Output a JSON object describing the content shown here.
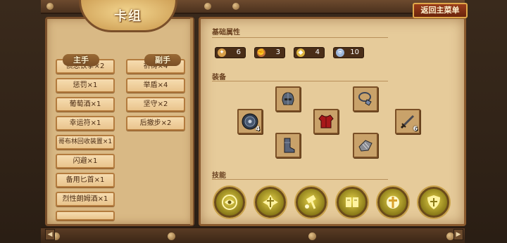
{
  "header": {
    "title": "卡组",
    "back_button": "返回主菜单"
  },
  "left_panel": {
    "main_hand_label": "主手",
    "off_hand_label": "副手",
    "main_hand_cards": [
      "愤怒铁拳×2",
      "惩罚×1",
      "葡萄酒×1",
      "幸运符×1",
      "哥布林回收装置×1",
      "闪避×1",
      "备用匕首×1",
      "烈性朗姆酒×1"
    ],
    "off_hand_cards": [
      "祈祷×4",
      "举盾×4",
      "坚守×2",
      "后撤步×2"
    ]
  },
  "right_panel": {
    "basic_attrs_title": "基础属性",
    "equipment_title": "装备",
    "skills_title": "技能",
    "stats": [
      {
        "icon": "sword-star-icon",
        "value": "6",
        "color": "#d8a04a"
      },
      {
        "icon": "fist-icon",
        "value": "3",
        "color": "#c8743a"
      },
      {
        "icon": "shield-icon",
        "value": "4",
        "color": "#e0b640"
      },
      {
        "icon": "armor-icon",
        "value": "10",
        "color": "#9ab4d8"
      }
    ],
    "equipment": [
      {
        "name": "helmet-icon",
        "count": ""
      },
      {
        "name": "round-shield-icon",
        "count": "4"
      },
      {
        "name": "chest-armor-icon",
        "count": ""
      },
      {
        "name": "amulet-icon",
        "count": ""
      },
      {
        "name": "sword-icon",
        "count": "6"
      },
      {
        "name": "boots-icon",
        "count": ""
      },
      {
        "name": "gauntlet-icon",
        "count": ""
      }
    ],
    "skills": [
      "eye-sigil-icon",
      "holy-cross-icon",
      "hammer-strike-icon",
      "tome-icon",
      "divine-light-icon",
      "shield-sigil-icon"
    ]
  }
}
